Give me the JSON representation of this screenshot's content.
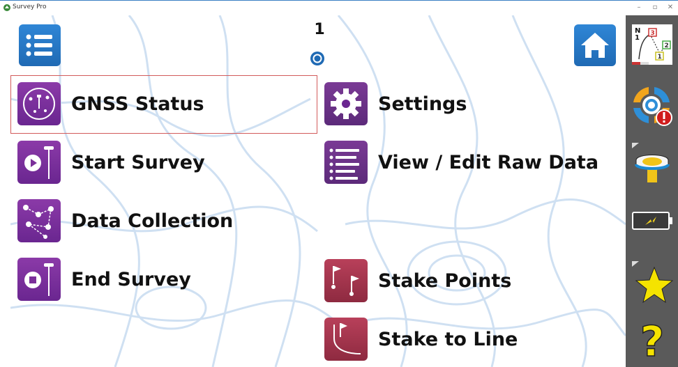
{
  "window": {
    "title": "Survey Pro",
    "controls": {
      "minimize": "–",
      "maximize": "▫",
      "close": "✕"
    }
  },
  "header": {
    "page_number": "1",
    "menu_icon": "list-menu-icon",
    "home_icon": "home-icon",
    "page_indicator_icon": "page-dot-icon"
  },
  "menu": {
    "left": [
      {
        "label": "GNSS Status",
        "icon": "gnss-status-icon",
        "selected": true
      },
      {
        "label": "Start Survey",
        "icon": "start-survey-icon"
      },
      {
        "label": "Data Collection",
        "icon": "data-collection-icon"
      },
      {
        "label": "End Survey",
        "icon": "end-survey-icon"
      }
    ],
    "right": [
      {
        "label": "Settings",
        "icon": "gear-icon"
      },
      {
        "label": "View / Edit Raw Data",
        "icon": "raw-data-icon"
      },
      {
        "label": "Stake Points",
        "icon": "stake-points-icon"
      },
      {
        "label": "Stake to Line",
        "icon": "stake-line-icon"
      }
    ]
  },
  "sidebar": {
    "items": [
      {
        "icon": "map-view-icon",
        "map_labels": [
          "N",
          "1",
          "3",
          "2",
          "1"
        ]
      },
      {
        "icon": "settings-warning-icon"
      },
      {
        "icon": "gnss-receiver-icon"
      },
      {
        "icon": "battery-icon"
      },
      {
        "icon": "favorites-star-icon"
      },
      {
        "icon": "help-icon",
        "label": "?"
      }
    ]
  },
  "colors": {
    "accent_blue": "#2277c8",
    "purple": "#7b2f9a",
    "maroon": "#a83650",
    "sidebar_bg": "#5a5a5a",
    "selection_border": "#d25a5a"
  }
}
